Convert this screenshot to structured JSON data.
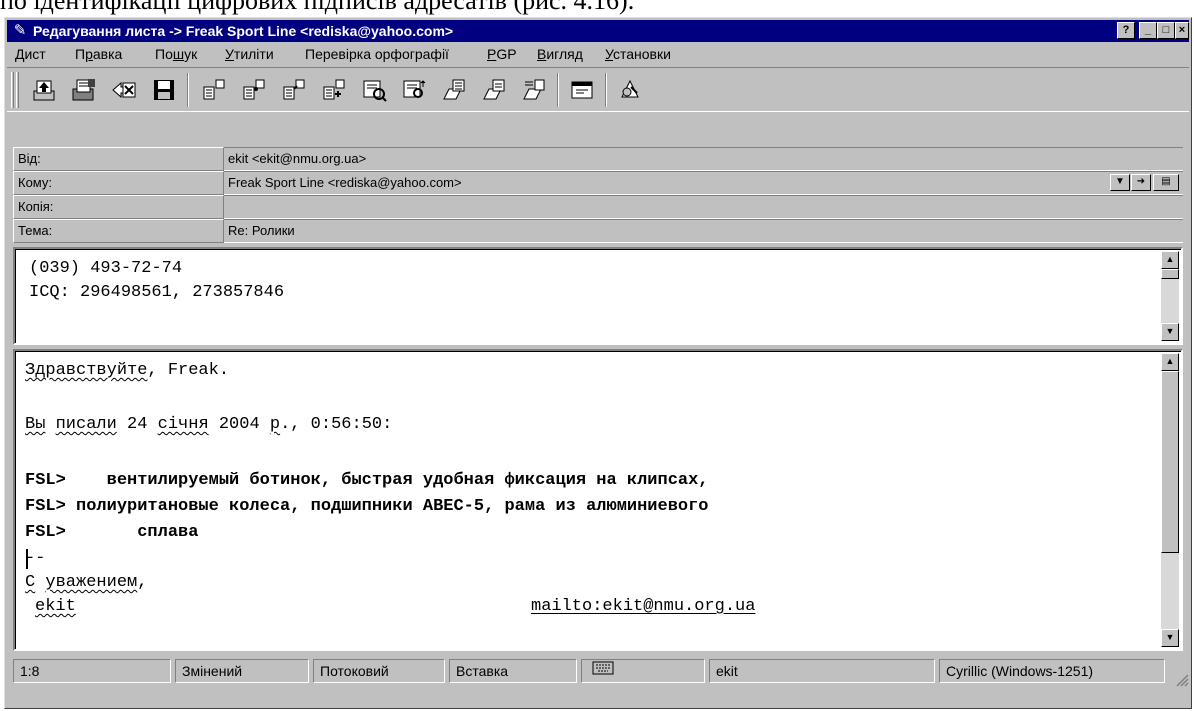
{
  "caption_fragment": "по ідентифікації цифрових підписів адресатів (рис. 4.16).",
  "window": {
    "title": "Редагування листа -> Freak Sport Line <rediska@yahoo.com>",
    "title_icon": "envelope-pen-icon",
    "caption_buttons": [
      "help",
      "minimize",
      "maximize",
      "close"
    ]
  },
  "menu": [
    {
      "u": "Д",
      "rest": "ист"
    },
    {
      "pre": "П",
      "u": "р",
      "rest": "авка"
    },
    {
      "pre": "По",
      "u": "ш",
      "rest": "ук"
    },
    {
      "u": "У",
      "rest": "тиліти"
    },
    {
      "pre": "Перевірка орфографії",
      "u": "",
      "rest": ""
    },
    {
      "u": "P",
      "rest": "GP"
    },
    {
      "u": "В",
      "rest": "игляд"
    },
    {
      "u": "У",
      "rest": "становки"
    }
  ],
  "toolbar": {
    "icons": [
      "send-icon",
      "save-draft-icon",
      "delete-icon",
      "save-icon",
      "attach-file-icon",
      "attach-copy-icon",
      "attach-link-icon",
      "attach-more-icon",
      "address-book-icon",
      "check-names-icon",
      "insert-template-icon",
      "insert-signature-icon",
      "insert-quote-icon",
      "properties-icon",
      "settings-icon"
    ]
  },
  "headers": {
    "from_label": "Від:",
    "from_value": "ekit <ekit@nmu.org.ua>",
    "to_label": "Кому:",
    "to_value": "Freak Sport Line <rediska@yahoo.com>",
    "cc_label": "Копія:",
    "cc_value": "",
    "subject_label": "Тема:",
    "subject_value": "Re: Ролики"
  },
  "signature_pane": {
    "line1": "(039) 493-72-74",
    "line2": "ICQ: 296498561, 273857846"
  },
  "body": {
    "greet_word": "Здравствуйте",
    "greet_rest": ", Freak.",
    "wrote_a": "Вы",
    "wrote_b": "писали",
    "wrote_c": " 24 ",
    "wrote_d": "січня",
    "wrote_e": " 2004 ",
    "wrote_f": "р",
    "wrote_g": "., 0:56:50:",
    "quote1": "FSL>    вентилируемый ботинок, быстрая удобная фиксация на клипсах,",
    "quote2": "FSL> полиуритановые колеса, подшипники ABEC-5, рама из алюминиевого",
    "quote3": "FSL>       сплава",
    "sig_sep": "--",
    "regards_a": "С",
    "regards_b": "уважением",
    "regards_c": ",",
    "signer": "ekit",
    "mailto": "mailto:ekit@nmu.org.ua"
  },
  "status": {
    "position": "1:8",
    "modified": "Змінений",
    "mode": "Потоковий",
    "insert": "Вставка",
    "icon": "keyboard-icon",
    "account": "ekit",
    "encoding": "Cyrillic (Windows-1251)"
  }
}
